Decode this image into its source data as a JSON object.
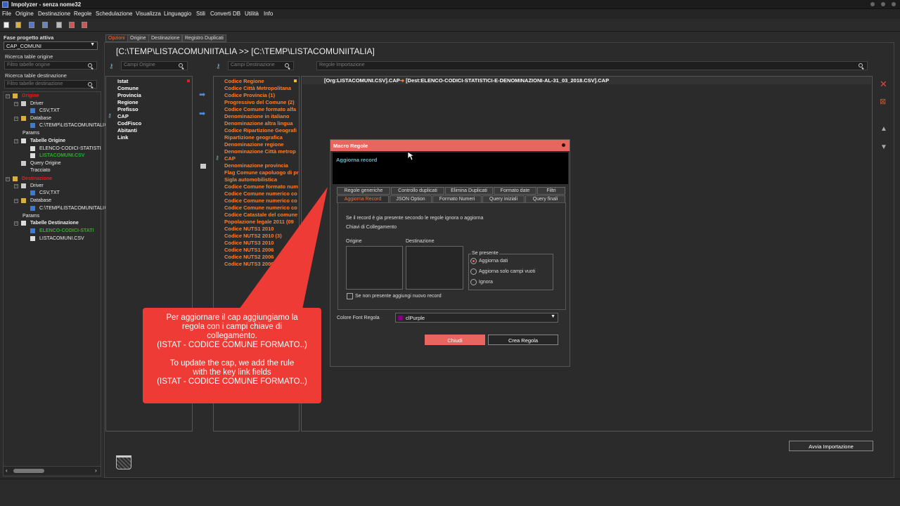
{
  "window": {
    "title": "Impolyzer - senza nome32"
  },
  "menu": [
    "File",
    "Origine",
    "Destinazione",
    "Regole",
    "Schedulazione",
    "Visualizza",
    "Linguaggio",
    "Stili",
    "Converti DB",
    "Utilità",
    "Info"
  ],
  "left": {
    "phase_label": "Fase progetto attiva",
    "phase_value": "CAP_COMUNI",
    "search_origin_label": "Ricerca table origine",
    "search_origin_placeholder": "Filtro tabelle origine",
    "search_dest_label": "Ricerca table destinazione",
    "search_dest_placeholder": "Filtro tabelle destinazione"
  },
  "tree": {
    "origine": "Origine",
    "o_driver": "Driver",
    "o_csv": "CSV,TXT",
    "o_database": "Database",
    "o_path": "C:\\TEMP\\LISTACOMUNITALIA",
    "o_params": "Params",
    "o_tabelle": "Tabelle Origine",
    "o_t1": "ELENCO-CODICI-STATISTI",
    "o_t2": "LISTACOMUNI.CSV",
    "o_query": "Query Origine",
    "o_tracciato": "Tracciato",
    "destinazione": "Destinazione",
    "d_driver": "Driver",
    "d_csv": "CSV,TXT",
    "d_database": "Database",
    "d_path": "C:\\TEMP\\LISTACOMUNITALIA",
    "d_params": "Params",
    "d_tabelle": "Tabelle Destinazione",
    "d_t1": "ELENCO-CODICI-STATI",
    "d_t2": "LISTACOMUNI.CSV"
  },
  "tabs": [
    "Opzioni",
    "Origine",
    "Destinazione",
    "Registro Duplicati"
  ],
  "path_title": "[C:\\TEMP\\LISTACOMUNIITALIA >> [C:\\TEMP\\LISTACOMUNIITALIA]",
  "search": {
    "origin_fields": "Campi Origine",
    "dest_fields": "Campi Destinazione",
    "rules": "Regole Importazione"
  },
  "origin_fields": [
    "Istat",
    "Comune",
    "Provincia",
    "Regione",
    "Prefisso",
    "CAP",
    "CodFisco",
    "Abitanti",
    "Link"
  ],
  "dest_fields": [
    "Codice Regione",
    "Codice Città Metropolitana",
    "Codice Provincia (1)",
    "Progressivo del Comune (2)",
    "Codice Comune formato alfa",
    "Denominazione in italiano",
    "Denominazione altra lingua",
    "Codice Ripartizione Geografi",
    "Ripartizione geografica",
    "Denominazione regione",
    "Denominazione Città metrop",
    "CAP",
    "Denominazione provincia",
    "Flag Comune capoluogo di pr",
    "Sigla automobilistica",
    "Codice Comune formato num",
    "Codice Comune numerico co",
    "Codice Comune numerico co",
    "Codice Comune numerico co",
    "Codice Catastale del comune",
    "Popolazione legale 2011 (09",
    "Codice NUTS1 2010",
    "Codice NUTS2 2010 (3)",
    "Codice NUTS3 2010",
    "Codice NUTS1 2006",
    "Codice NUTS2 2006",
    "Codice NUTS3 2006"
  ],
  "rule_header": {
    "org": "[Org:LISTACOMUNI.CSV].CAP",
    "dest": "[Dest:ELENCO-CODICI-STATISTICI-E-DENOMINAZIONI-AL-31_03_2018.CSV].CAP"
  },
  "dialog": {
    "title": "Macro Regole",
    "subtitle": "Aggiorna record",
    "tabs_row1": [
      "Regole generiche",
      "Controllo duplicati",
      "Elimina Duplicati",
      "Formato date",
      "Filtri"
    ],
    "tabs_row2": [
      "Aggiorna Record",
      "JSON Option",
      "Formato Numeri",
      "Query iniziali",
      "Query finali"
    ],
    "desc": "Se il record è gia presente secondo le regole  ignora o aggiorna",
    "keys": "Chiavi di Collegamento",
    "origin": "Origine",
    "destination": "Destinazione",
    "group": "Se presente",
    "opt1": "Aggiorna dati",
    "opt2": "Aggiorna solo campi vuoti",
    "opt3": "Ignora",
    "checkbox": "Se non presente aggiungi nuovo record",
    "font_label": "Colore Font Regola",
    "font_value": "clPurple",
    "close_btn": "Chiudi",
    "create_btn": "Crea Regola"
  },
  "callout": {
    "it1": "Per aggiornare il cap aggiungiamo la",
    "it2": "regola con i campi chiave di",
    "it3": "collegamento.",
    "it4": "(ISTAT - CODICE COMUNE FORMATO..)",
    "en1": "To update the cap, we add the rule",
    "en2": "with the key link fields",
    "en3": "(ISTAT - CODICE COMUNE FORMATO..)"
  },
  "avvia_btn": "Avvia Importazione",
  "colors": {
    "accent": "#e8665d",
    "orange": "#ff7f2a",
    "callout": "#ef3b36",
    "green": "#2eae2e",
    "red": "#e02020"
  }
}
